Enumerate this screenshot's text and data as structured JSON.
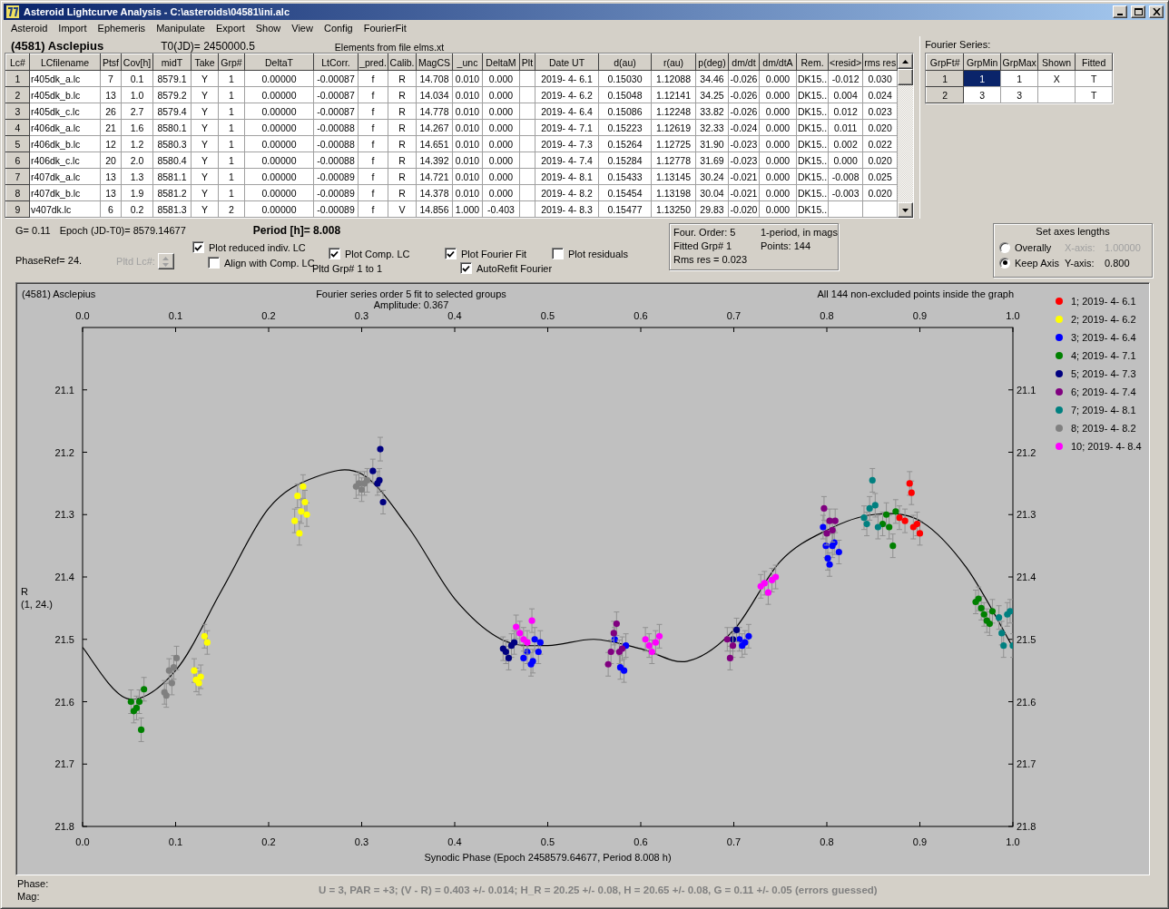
{
  "window": {
    "title": "Asteroid Lightcurve Analysis - C:\\asteroids\\04581\\ini.alc"
  },
  "menu": [
    "Asteroid",
    "Import",
    "Ephemeris",
    "Manipulate",
    "Export",
    "Show",
    "View",
    "Config",
    "FourierFit"
  ],
  "header": {
    "object": "(4581) Asclepius",
    "t0": "T0(JD)= 2450000.5",
    "elements": "Elements from file elms.xt"
  },
  "lc_table": {
    "columns": [
      "Lc#",
      "LCfilename",
      "Ptsf",
      "Cov[h]",
      "midT",
      "Take",
      "Grp#",
      "DeltaT",
      "LtCorr.",
      "_pred.",
      "Calib.",
      "MagCS",
      "_unc",
      "DeltaM",
      "Plt",
      "Date UT",
      "d(au)",
      "r(au)",
      "p(deg)",
      "dm/dt",
      "dm/dtA",
      "Rem.",
      "<resid>",
      "rms res"
    ],
    "rows": [
      {
        "cells": [
          "1",
          "r405dk_a.lc",
          "7",
          "0.1",
          "8579.1",
          "Y",
          "1",
          "0.00000",
          "-0.00087",
          "f",
          "R",
          "14.708",
          "0.010",
          "0.000",
          null,
          "2019- 4- 6.1",
          "0.15030",
          "1.12088",
          "34.46",
          "-0.026",
          "0.000",
          "DK15..",
          "-0.012",
          "0.030"
        ]
      },
      {
        "cells": [
          "2",
          "r405dk_b.lc",
          "13",
          "1.0",
          "8579.2",
          "Y",
          "1",
          "0.00000",
          "-0.00087",
          "f",
          "R",
          "14.034",
          "0.010",
          "0.000",
          null,
          "2019- 4- 6.2",
          "0.15048",
          "1.12141",
          "34.25",
          "-0.026",
          "0.000",
          "DK15..",
          "0.004",
          "0.024"
        ]
      },
      {
        "cells": [
          "3",
          "r405dk_c.lc",
          "26",
          "2.7",
          "8579.4",
          "Y",
          "1",
          "0.00000",
          "-0.00087",
          "f",
          "R",
          "14.778",
          "0.010",
          "0.000",
          null,
          "2019- 4- 6.4",
          "0.15086",
          "1.12248",
          "33.82",
          "-0.026",
          "0.000",
          "DK15..",
          "0.012",
          "0.023"
        ]
      },
      {
        "cells": [
          "4",
          "r406dk_a.lc",
          "21",
          "1.6",
          "8580.1",
          "Y",
          "1",
          "0.00000",
          "-0.00088",
          "f",
          "R",
          "14.267",
          "0.010",
          "0.000",
          null,
          "2019- 4- 7.1",
          "0.15223",
          "1.12619",
          "32.33",
          "-0.024",
          "0.000",
          "DK15..",
          "0.011",
          "0.020"
        ]
      },
      {
        "cells": [
          "5",
          "r406dk_b.lc",
          "12",
          "1.2",
          "8580.3",
          "Y",
          "1",
          "0.00000",
          "-0.00088",
          "f",
          "R",
          "14.651",
          "0.010",
          "0.000",
          null,
          "2019- 4- 7.3",
          "0.15264",
          "1.12725",
          "31.90",
          "-0.023",
          "0.000",
          "DK15..",
          "0.002",
          "0.022"
        ]
      },
      {
        "cells": [
          "6",
          "r406dk_c.lc",
          "20",
          "2.0",
          "8580.4",
          "Y",
          "1",
          "0.00000",
          "-0.00088",
          "f",
          "R",
          "14.392",
          "0.010",
          "0.000",
          null,
          "2019- 4- 7.4",
          "0.15284",
          "1.12778",
          "31.69",
          "-0.023",
          "0.000",
          "DK15..",
          "0.000",
          "0.020"
        ]
      },
      {
        "cells": [
          "7",
          "r407dk_a.lc",
          "13",
          "1.3",
          "8581.1",
          "Y",
          "1",
          "0.00000",
          "-0.00089",
          "f",
          "R",
          "14.721",
          "0.010",
          "0.000",
          null,
          "2019- 4- 8.1",
          "0.15433",
          "1.13145",
          "30.24",
          "-0.021",
          "0.000",
          "DK15..",
          "-0.008",
          "0.025"
        ]
      },
      {
        "cells": [
          "8",
          "r407dk_b.lc",
          "13",
          "1.9",
          "8581.2",
          "Y",
          "1",
          "0.00000",
          "-0.00089",
          "f",
          "R",
          "14.378",
          "0.010",
          "0.000",
          null,
          "2019- 4- 8.2",
          "0.15454",
          "1.13198",
          "30.04",
          "-0.021",
          "0.000",
          "DK15..",
          "-0.003",
          "0.020"
        ]
      },
      {
        "cells": [
          "9",
          "v407dk.lc",
          "6",
          "0.2",
          "8581.3",
          "Y",
          "2",
          "0.00000",
          "-0.00089",
          "f",
          "V",
          "14.856",
          "1.000",
          "-0.403",
          null,
          "2019- 4- 8.3",
          "0.15477",
          "1.13250",
          "29.83",
          "-0.020",
          "0.000",
          "DK15..",
          null,
          null
        ]
      }
    ]
  },
  "fourier": {
    "label": "Fourier Series:",
    "columns": [
      "GrpFt#",
      "GrpMin",
      "GrpMax",
      "Shown",
      "Fitted"
    ],
    "rows": [
      {
        "cells": [
          "1",
          {
            "text": "1",
            "selected": true
          },
          {
            "text": "1",
            "selected": false
          },
          {
            "text": "X",
            "selected": false
          },
          {
            "text": "T",
            "selected": false
          }
        ]
      },
      {
        "cells": [
          "2",
          {
            "text": "3",
            "selected": false
          },
          {
            "text": "3",
            "selected": false
          },
          {
            "selected": false
          },
          {
            "text": "T",
            "selected": false
          }
        ]
      }
    ]
  },
  "stats": {
    "g": "G= 0.11",
    "epoch": "Epoch (JD-T0)= 8579.14677",
    "period": "Period [h]= 8.008",
    "phase_ref": "PhaseRef= 24."
  },
  "pltd_lc": {
    "label": "Pltd Lc#:",
    "disabled": true
  },
  "checkboxes": [
    {
      "label": "Plot reduced indiv. LC",
      "checked": true
    },
    {
      "label": "Align with Comp. LC",
      "checked": false
    },
    {
      "label": "Plot Comp. LC",
      "checked": true
    },
    {
      "label": "Plot Fourier Fit",
      "checked": true
    },
    {
      "label": "AutoRefit Fourier",
      "checked": true
    },
    {
      "label": "Plot residuals",
      "checked": false
    }
  ],
  "pltd_grp": "Pltd Grp#  1  to  1",
  "fit_info": [
    "Four. Order:  5",
    "1-period, in mags",
    "Fitted Grp# 1",
    "Points: 144",
    "Rms res     = 0.023"
  ],
  "axes": {
    "title": "Set axes lengths",
    "options": [
      {
        "label": "Overally",
        "selected": false
      },
      {
        "label": "Keep Axis",
        "selected": true
      }
    ],
    "x_axis": {
      "label": "X-axis:",
      "value": "1.00000",
      "disabled": true
    },
    "y_axis": {
      "label": "Y-axis:",
      "value": "0.800",
      "disabled": false
    }
  },
  "plot": {
    "object": "(4581) Asclepius",
    "amplitude": "Amplitude: 0.367",
    "note": "All 144 non-excluded points inside the graph",
    "y_note": "(1, 24.)",
    "top_ticks": [
      "0.0",
      "0.1",
      "0.2",
      "0.3",
      "0.4",
      "0.5",
      "0.6",
      "0.7",
      "0.8",
      "0.9",
      "1.0"
    ],
    "right_ticks": [
      "21.1",
      "21.2",
      "21.3",
      "21.4",
      "21.5",
      "21.6",
      "21.7",
      "21.8"
    ],
    "chart_data": {
      "type": "scatter",
      "title": "Fourier series order 5 fit to selected groups",
      "xlabel": "Synodic Phase (Epoch 2458579.64677, Period 8.008 h)",
      "ylabel": "R",
      "xlim": [
        0,
        1
      ],
      "ylim": [
        21.8,
        21.0
      ],
      "xticks": [
        {
          "value": 0,
          "label": "0.0"
        },
        {
          "value": 0.1,
          "label": "0.1"
        },
        {
          "value": 0.2,
          "label": "0.2"
        },
        {
          "value": 0.3,
          "label": "0.3"
        },
        {
          "value": 0.4,
          "label": "0.4"
        },
        {
          "value": 0.5,
          "label": "0.5"
        },
        {
          "value": 0.6,
          "label": "0.6"
        },
        {
          "value": 0.7,
          "label": "0.7"
        },
        {
          "value": 0.8,
          "label": "0.8"
        },
        {
          "value": 0.9,
          "label": "0.9"
        },
        {
          "value": 1,
          "label": "1.0"
        }
      ],
      "yticks": [
        {
          "value": 21.1,
          "label": "21.1"
        },
        {
          "value": 21.2,
          "label": "21.2"
        },
        {
          "value": 21.3,
          "label": "21.3"
        },
        {
          "value": 21.4,
          "label": "21.4"
        },
        {
          "value": 21.5,
          "label": "21.5"
        },
        {
          "value": 21.6,
          "label": "21.6"
        },
        {
          "value": 21.7,
          "label": "21.7"
        },
        {
          "value": 21.8,
          "label": "21.8"
        }
      ],
      "legend": "right",
      "series": [
        {
          "type": "line",
          "color": "#000000",
          "x": [
            0,
            0.048,
            0.1,
            0.15,
            0.2,
            0.25,
            0.3,
            0.35,
            0.4,
            0.45,
            0.5,
            0.55,
            0.6,
            0.65,
            0.7,
            0.75,
            0.8,
            0.85,
            0.9,
            0.95,
            1
          ],
          "values": [
            21.513,
            21.595,
            21.55,
            21.42,
            21.29,
            21.24,
            21.235,
            21.32,
            21.435,
            21.5,
            21.51,
            21.5,
            21.515,
            21.535,
            21.485,
            21.375,
            21.325,
            21.3,
            21.31,
            21.385,
            21.513
          ]
        },
        {
          "type": "scatter",
          "name": "1; 2019- 4- 6.1",
          "color": "#ff0000",
          "x": [
            0.878,
            0.884,
            0.889,
            0.891,
            0.893,
            0.897,
            0.9
          ],
          "values": [
            21.305,
            21.31,
            21.25,
            21.265,
            21.32,
            21.315,
            21.33
          ]
        },
        {
          "type": "scatter",
          "name": "2; 2019- 4- 6.2",
          "color": "#ffff00",
          "x": [
            0.228,
            0.231,
            0.233,
            0.235,
            0.237,
            0.239,
            0.241,
            0.12,
            0.122,
            0.125,
            0.127,
            0.131,
            0.134
          ],
          "values": [
            21.31,
            21.27,
            21.33,
            21.295,
            21.255,
            21.28,
            21.3,
            21.55,
            21.565,
            21.57,
            21.56,
            21.495,
            21.505
          ]
        },
        {
          "type": "scatter",
          "name": "3; 2019- 4- 6.4",
          "color": "#0000ff",
          "x": [
            0.492,
            0.474,
            0.478,
            0.482,
            0.484,
            0.486,
            0.49,
            0.572,
            0.578,
            0.582,
            0.584,
            0.716,
            0.706,
            0.709,
            0.712,
            0.796,
            0.799,
            0.801,
            0.803,
            0.806,
            0.808,
            0.813
          ],
          "values": [
            21.505,
            21.53,
            21.52,
            21.54,
            21.535,
            21.5,
            21.52,
            21.5,
            21.545,
            21.55,
            21.51,
            21.495,
            21.5,
            21.51,
            21.505,
            21.32,
            21.35,
            21.37,
            21.38,
            21.35,
            21.345,
            21.36
          ]
        },
        {
          "type": "scatter",
          "name": "4; 2019- 4- 7.1",
          "color": "#008000",
          "x": [
            0.052,
            0.055,
            0.058,
            0.061,
            0.063,
            0.066,
            0.86,
            0.864,
            0.867,
            0.871,
            0.874,
            0.96,
            0.963,
            0.966,
            0.969,
            0.972,
            0.975,
            0.978
          ],
          "values": [
            21.6,
            21.615,
            21.61,
            21.6,
            21.645,
            21.58,
            21.315,
            21.3,
            21.32,
            21.35,
            21.295,
            21.44,
            21.435,
            21.45,
            21.46,
            21.47,
            21.475,
            21.455
          ]
        },
        {
          "type": "scatter",
          "name": "5; 2019- 4- 7.3",
          "color": "#000080",
          "x": [
            0.452,
            0.455,
            0.458,
            0.461,
            0.464,
            0.312,
            0.317,
            0.32,
            0.323,
            0.319,
            0.699,
            0.703
          ],
          "values": [
            21.515,
            21.52,
            21.53,
            21.51,
            21.505,
            21.23,
            21.25,
            21.195,
            21.28,
            21.245,
            21.5,
            21.485
          ]
        },
        {
          "type": "scatter",
          "name": "6; 2019- 4- 7.4",
          "color": "#800080",
          "x": [
            0.565,
            0.568,
            0.571,
            0.574,
            0.577,
            0.58,
            0.693,
            0.696,
            0.699,
            0.797,
            0.8,
            0.803,
            0.806,
            0.809
          ],
          "values": [
            21.54,
            21.52,
            21.49,
            21.475,
            21.52,
            21.515,
            21.5,
            21.53,
            21.51,
            21.29,
            21.33,
            21.31,
            21.325,
            21.31
          ]
        },
        {
          "type": "scatter",
          "name": "7; 2019- 4- 8.1",
          "color": "#008080",
          "x": [
            0.84,
            0.843,
            0.846,
            0.849,
            0.852,
            0.855,
            0.985,
            0.988,
            0.99,
            0.994,
            0.997,
            1.0
          ],
          "values": [
            21.305,
            21.315,
            21.29,
            21.245,
            21.285,
            21.32,
            21.465,
            21.49,
            21.51,
            21.46,
            21.455,
            21.51
          ]
        },
        {
          "type": "scatter",
          "name": "8; 2019- 4- 8.2",
          "color": "#808080",
          "x": [
            0.088,
            0.09,
            0.093,
            0.096,
            0.098,
            0.101,
            0.294,
            0.297,
            0.3,
            0.303,
            0.306
          ],
          "values": [
            21.585,
            21.59,
            21.55,
            21.57,
            21.545,
            21.53,
            21.255,
            21.25,
            21.26,
            21.25,
            21.245
          ]
        },
        {
          "type": "scatter",
          "name": "10; 2019- 4- 8.4",
          "color": "#ff00ff",
          "x": [
            0.466,
            0.47,
            0.474,
            0.478,
            0.483,
            0.605,
            0.609,
            0.612,
            0.616,
            0.62,
            0.729,
            0.733,
            0.737,
            0.741,
            0.745
          ],
          "values": [
            21.48,
            21.49,
            21.5,
            21.505,
            21.47,
            21.5,
            21.51,
            21.52,
            21.505,
            21.495,
            21.415,
            21.41,
            21.425,
            21.405,
            21.4
          ]
        }
      ]
    }
  },
  "status": {
    "phase_label": "Phase:",
    "mag_label": "Mag:",
    "result": "U = 3, PAR = +3; (V - R) = 0.403 +/- 0.014; H_R = 20.25 +/- 0.08, H = 20.65 +/- 0.08, G = 0.11 +/- 0.05 (errors guessed)"
  }
}
